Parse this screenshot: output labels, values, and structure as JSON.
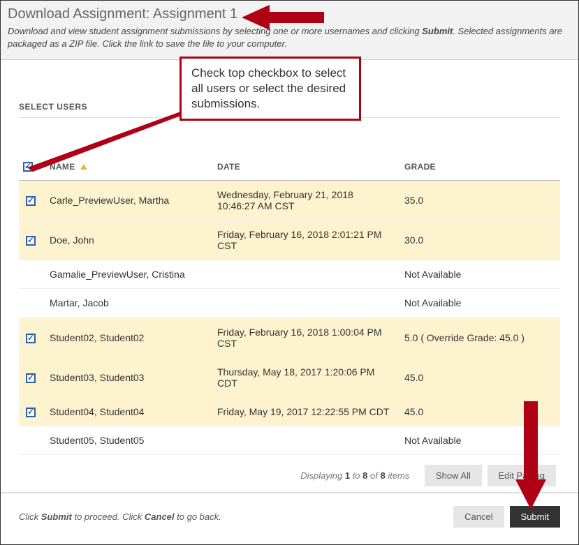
{
  "header": {
    "title": "Download Assignment: Assignment 1",
    "desc_pre": "Download and view student assignment submissions by selecting one or more usernames and clicking ",
    "desc_bold1": "Submit",
    "desc_mid": ". Selected assignments are packaged as a ZIP file. Click the link to save the file to your computer."
  },
  "annotation": {
    "box_text": "Check top checkbox to select all users or select the desired submissions."
  },
  "section": {
    "title": "SELECT USERS"
  },
  "table": {
    "headers": {
      "name": "NAME",
      "date": "DATE",
      "grade": "GRADE"
    },
    "rows": [
      {
        "checked": true,
        "name": "Carle_PreviewUser, Martha",
        "date": "Wednesday, February 21, 2018 10:46:27 AM CST",
        "grade": "35.0"
      },
      {
        "checked": true,
        "name": "Doe, John",
        "date": "Friday, February 16, 2018 2:01:21 PM CST",
        "grade": "30.0"
      },
      {
        "checked": false,
        "name": "Gamalie_PreviewUser, Cristina",
        "date": "",
        "grade": "Not Available"
      },
      {
        "checked": false,
        "name": "Martar, Jacob",
        "date": "",
        "grade": "Not Available"
      },
      {
        "checked": true,
        "name": "Student02, Student02",
        "date": "Friday, February 16, 2018 1:00:04 PM CST",
        "grade": "5.0 ( Override Grade: 45.0 )"
      },
      {
        "checked": true,
        "name": "Student03, Student03",
        "date": "Thursday, May 18, 2017 1:20:06 PM CDT",
        "grade": "45.0"
      },
      {
        "checked": true,
        "name": "Student04, Student04",
        "date": "Friday, May 19, 2017 12:22:55 PM CDT",
        "grade": "45.0"
      },
      {
        "checked": false,
        "name": "Student05, Student05",
        "date": "",
        "grade": "Not Available"
      }
    ]
  },
  "paging": {
    "display_pre": "Displaying ",
    "from": "1",
    "to_word": " to ",
    "to": "8",
    "of_word": " of ",
    "total": "8",
    "items_word": " items",
    "show_all": "Show All",
    "edit_paging": "Edit Paging"
  },
  "footer": {
    "hint_pre": "Click ",
    "hint_b1": "Submit",
    "hint_mid": " to proceed. Click ",
    "hint_b2": "Cancel",
    "hint_post": " to go back.",
    "cancel": "Cancel",
    "submit": "Submit"
  },
  "colors": {
    "accent_red": "#b00015"
  }
}
